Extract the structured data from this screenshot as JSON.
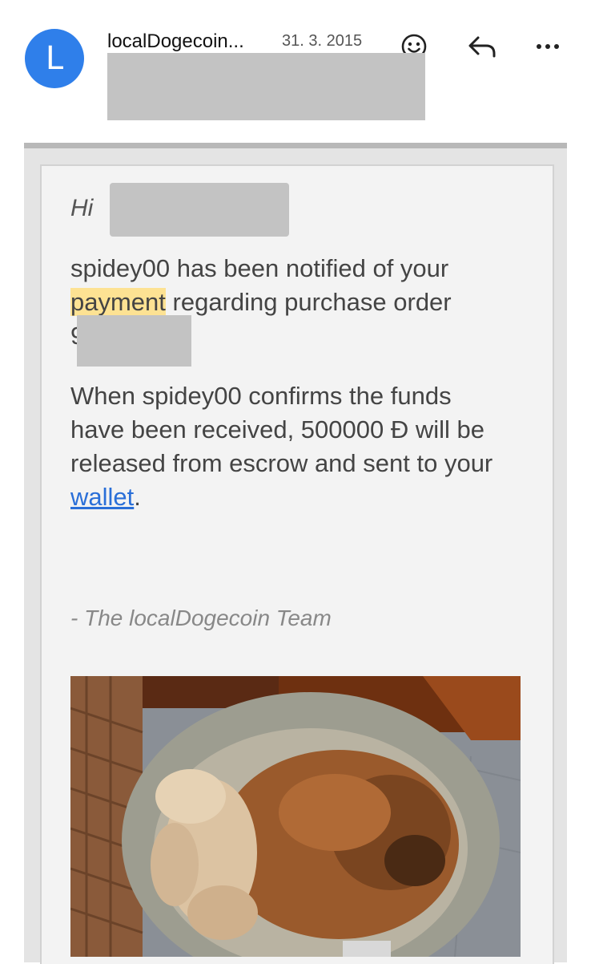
{
  "header": {
    "avatar_letter": "L",
    "sender": "localDogecoin...",
    "date": "31. 3. 2015",
    "icons": [
      "emoji-icon",
      "reply-icon",
      "more-icon"
    ]
  },
  "email": {
    "greeting": "Hi",
    "paragraph1_prefix": "spidey00 has been notified of your ",
    "paragraph1_highlight": "payment",
    "paragraph1_suffix": " regarding purchase order",
    "paragraph1_partial": "9",
    "paragraph2_prefix": "When spidey00 confirms the funds have been received, 500000 Ð will be released from escrow and sent to your ",
    "paragraph2_link": "wallet",
    "paragraph2_suffix": ".",
    "signature": "- The localDogecoin Team"
  },
  "colors": {
    "avatar": "#2f7fea",
    "highlight": "#fde293",
    "link": "#2a6fd8"
  }
}
